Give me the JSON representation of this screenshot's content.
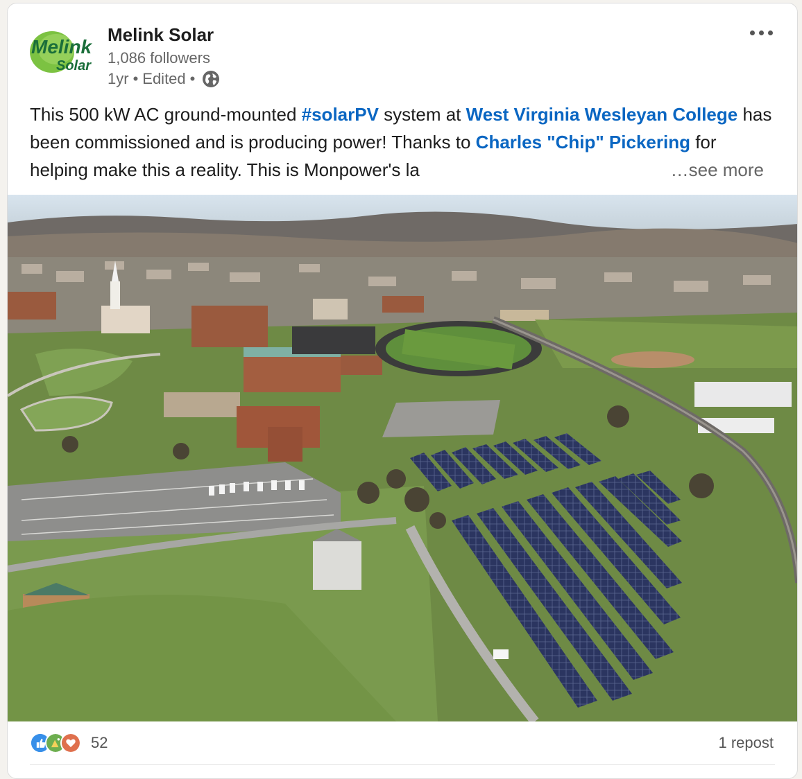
{
  "author": {
    "name": "Melink Solar",
    "followers": "1,086 followers",
    "time": "1yr",
    "edited": "Edited",
    "separator": "•",
    "visibility_icon": "globe-icon",
    "logo": {
      "line1": "Melink",
      "line2": "Solar",
      "brand_color": "#1a6e3a",
      "accent": "#7cc242"
    }
  },
  "post": {
    "text_parts": [
      {
        "t": "This 500 kW AC ground-mounted ",
        "link": false
      },
      {
        "t": "#solarPV",
        "link": true
      },
      {
        "t": " system at ",
        "link": false
      },
      {
        "t": "West Virginia Wesleyan College",
        "link": true
      },
      {
        "t": " has been commissioned and is producing power! Thanks to ",
        "link": false
      },
      {
        "t": "Charles \"Chip\" Pickering",
        "link": true
      },
      {
        "t": " for helping make this a reality. This is Monpower's la",
        "link": false
      }
    ],
    "see_more": "…see more",
    "image_alt_icon": "aerial-photo"
  },
  "social": {
    "reaction_icons": [
      "like-icon",
      "celebrate-icon",
      "love-icon"
    ],
    "reaction_count": "52",
    "reposts": "1 repost"
  },
  "colors": {
    "link": "#0a66c2",
    "muted": "#666666"
  }
}
